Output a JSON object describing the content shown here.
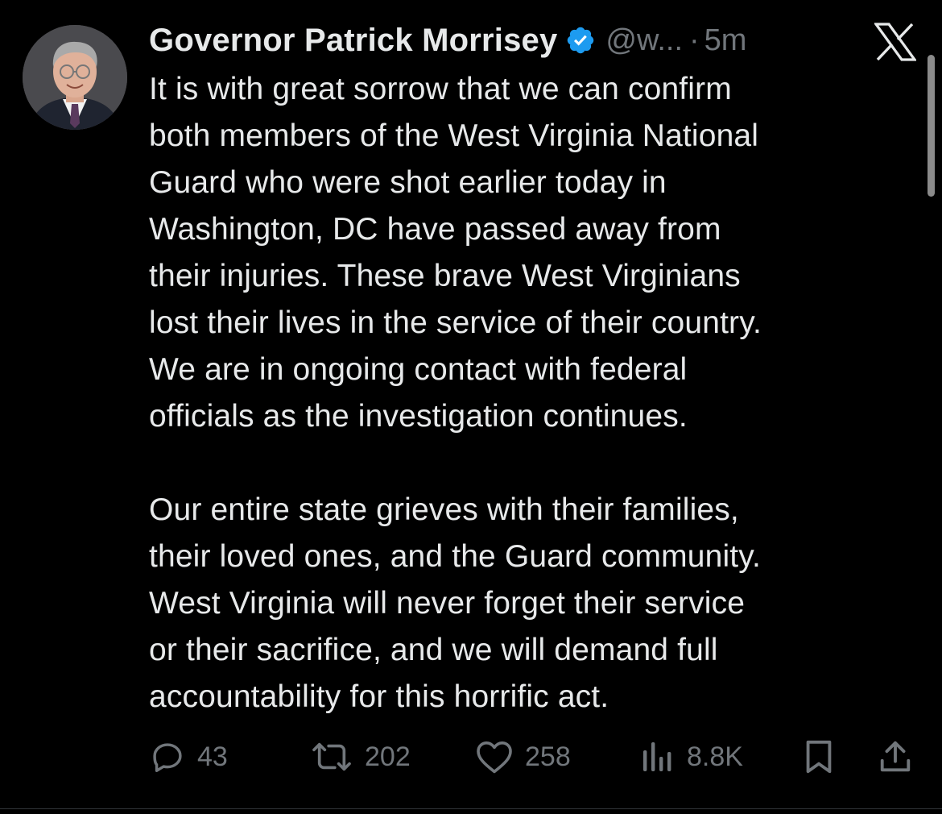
{
  "author": {
    "display_name": "Governor Patrick Morrisey",
    "handle": "@w...",
    "separator": "·",
    "time": "5m",
    "verified": true,
    "verified_color": "#1d9bf0"
  },
  "platform_logo": "x-logo-icon",
  "tweet": {
    "paragraphs": [
      "It is with great sorrow that we can confirm\nboth members of the West Virginia National\nGuard who were shot earlier today in\nWashington, DC have passed away from\ntheir injuries. These brave West Virginians\nlost their lives in the service of their country.\nWe are in ongoing contact with federal\nofficials as the investigation continues.",
      "Our entire state grieves with their families,\ntheir loved ones, and the Guard community.\nWest Virginia will never forget their service\nor their sacrifice, and we will demand full\naccountability for this horrific act."
    ]
  },
  "actions": {
    "replies": {
      "icon": "reply-icon",
      "count": "43"
    },
    "reposts": {
      "icon": "repost-icon",
      "count": "202"
    },
    "likes": {
      "icon": "heart-icon",
      "count": "258"
    },
    "views": {
      "icon": "views-icon",
      "count": "8.8K"
    },
    "bookmark": {
      "icon": "bookmark-icon"
    },
    "share": {
      "icon": "share-icon"
    }
  },
  "colors": {
    "background": "#000000",
    "text": "#e7e9ea",
    "secondary": "#71767b",
    "accent": "#1d9bf0"
  }
}
